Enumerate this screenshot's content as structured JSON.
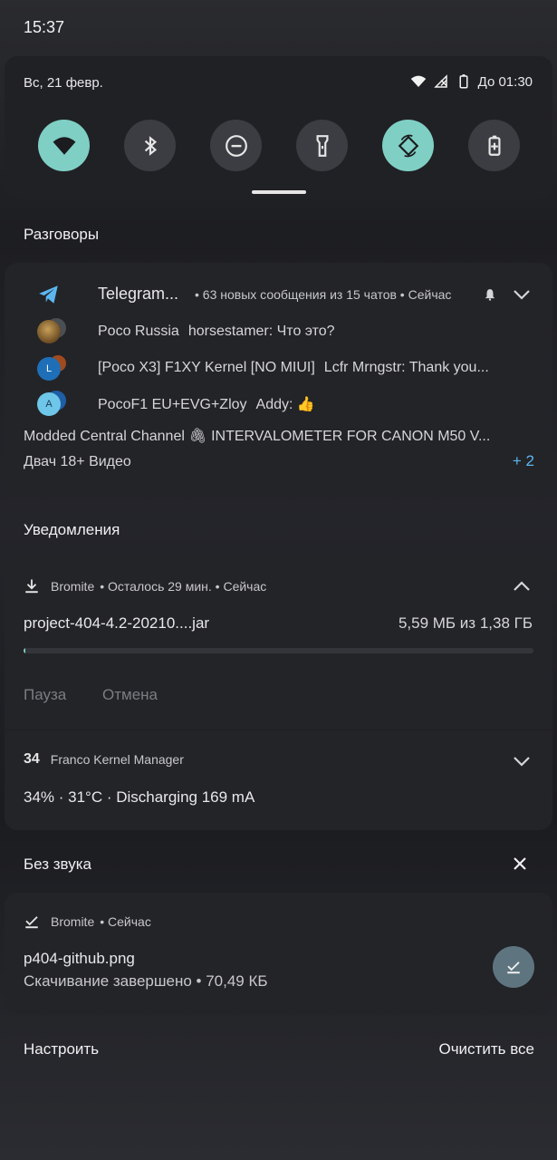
{
  "status_bar": {
    "time": "15:37"
  },
  "quick_settings": {
    "date": "Вс, 21 февр.",
    "battery_text": "До 01:30",
    "tiles": [
      {
        "name": "wifi",
        "active": true
      },
      {
        "name": "bluetooth",
        "active": false
      },
      {
        "name": "do-not-disturb",
        "active": false
      },
      {
        "name": "flashlight",
        "active": false
      },
      {
        "name": "auto-rotate",
        "active": true
      },
      {
        "name": "battery-saver",
        "active": false
      }
    ]
  },
  "conversations": {
    "section_title": "Разговоры",
    "app_name": "Telegram...",
    "meta": "• 63 новых сообщения из 15 чатов • Сейчас",
    "rows": [
      {
        "chat": "Poco Russia",
        "message": "horsestamer: Что это?",
        "avatar": ""
      },
      {
        "chat": "[Poco X3] F1XY Kernel [NO MIUI]",
        "message": "Lcfr Mrngstr: Thank you...",
        "avatar": "L"
      },
      {
        "chat": "PocoF1 EU+EVG+Zloy",
        "message": "Addy: 👍",
        "avatar": "A"
      }
    ],
    "extra_line_1": "Modded Central Channel 🖇 INTERVALOMETER FOR CANON M50 V...",
    "extra_line_2": "Двач 18+ Видео",
    "more_count": "+ 2"
  },
  "notifications": {
    "section_title": "Уведомления",
    "download": {
      "app": "Bromite",
      "meta": "• Осталось 29 мин. • Сейчас",
      "file": "project-404-4.2-20210....jar",
      "size": "5,59 МБ из 1,38 ГБ",
      "progress": 0.004,
      "pause_label": "Пауза",
      "cancel_label": "Отмена"
    },
    "franco": {
      "icon_text": "34",
      "app": "Franco Kernel Manager",
      "text": "34% · 31°C · Discharging 169 mA"
    }
  },
  "silent": {
    "section_title": "Без звука",
    "notification": {
      "app": "Bromite",
      "meta": "• Сейчас",
      "title": "p404-github.png",
      "subtitle": "Скачивание завершено • 70,49 КБ"
    }
  },
  "footer": {
    "manage_label": "Настроить",
    "clear_all_label": "Очистить все"
  },
  "colors": {
    "accent": "#7fcfc4",
    "link": "#5cb7f0",
    "card": "#232428"
  }
}
